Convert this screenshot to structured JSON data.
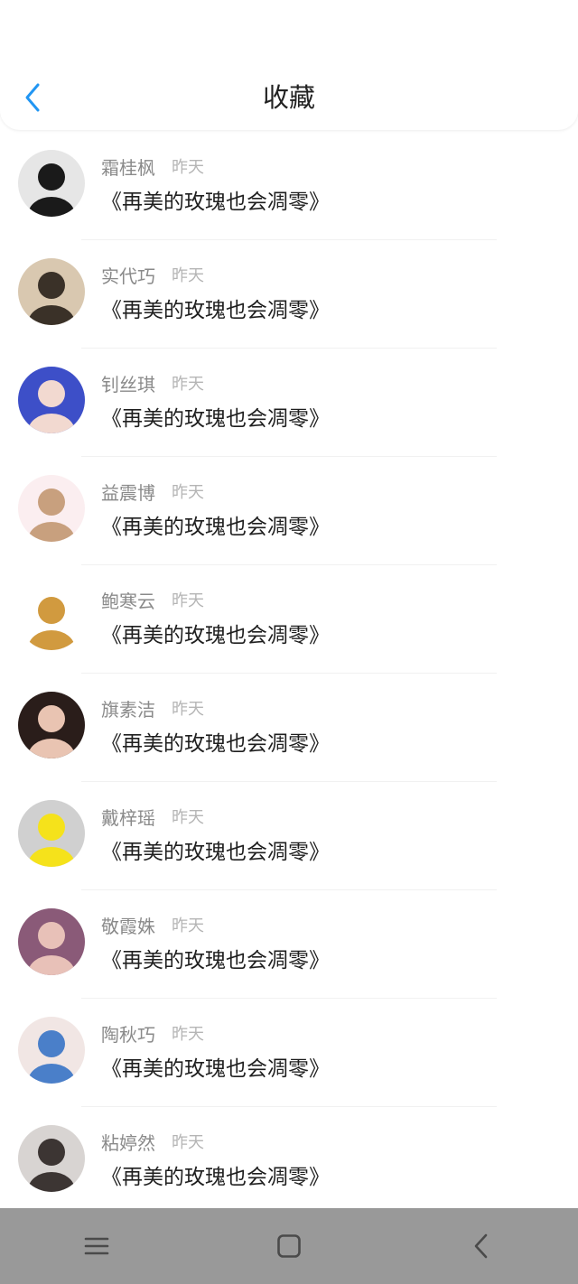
{
  "header": {
    "title": "收藏"
  },
  "accent_color": "#2196f3",
  "favorites": [
    {
      "name": "霜桂枫",
      "time": "昨天",
      "content": "《再美的玫瑰也会凋零》",
      "avatar_colors": [
        "#e6e6e6",
        "#1a1a1a"
      ]
    },
    {
      "name": "实代巧",
      "time": "昨天",
      "content": "《再美的玫瑰也会凋零》",
      "avatar_colors": [
        "#d9c8b0",
        "#3a3128"
      ]
    },
    {
      "name": "钊丝琪",
      "time": "昨天",
      "content": "《再美的玫瑰也会凋零》",
      "avatar_colors": [
        "#3d4fc8",
        "#f2d9d0"
      ]
    },
    {
      "name": "益震博",
      "time": "昨天",
      "content": "《再美的玫瑰也会凋零》",
      "avatar_colors": [
        "#fbeef0",
        "#c8a07e"
      ]
    },
    {
      "name": "鲍寒云",
      "time": "昨天",
      "content": "《再美的玫瑰也会凋零》",
      "avatar_colors": [
        "#ffffff",
        "#d19a3f"
      ]
    },
    {
      "name": "旗素洁",
      "time": "昨天",
      "content": "《再美的玫瑰也会凋零》",
      "avatar_colors": [
        "#2a1d1a",
        "#e9c4b2"
      ]
    },
    {
      "name": "戴梓瑶",
      "time": "昨天",
      "content": "《再美的玫瑰也会凋零》",
      "avatar_colors": [
        "#d0d0d0",
        "#f5e21b"
      ]
    },
    {
      "name": "敬霞姝",
      "time": "昨天",
      "content": "《再美的玫瑰也会凋零》",
      "avatar_colors": [
        "#8a5a78",
        "#e8c1b8"
      ]
    },
    {
      "name": "陶秋巧",
      "time": "昨天",
      "content": "《再美的玫瑰也会凋零》",
      "avatar_colors": [
        "#f1e6e4",
        "#4a7fc9"
      ]
    },
    {
      "name": "粘婷然",
      "time": "昨天",
      "content": "《再美的玫瑰也会凋零》",
      "avatar_colors": [
        "#d8d4d2",
        "#3c3533"
      ]
    }
  ],
  "navbar": {
    "icons": [
      "menu-icon",
      "home-square-icon",
      "back-triangle-icon"
    ]
  }
}
